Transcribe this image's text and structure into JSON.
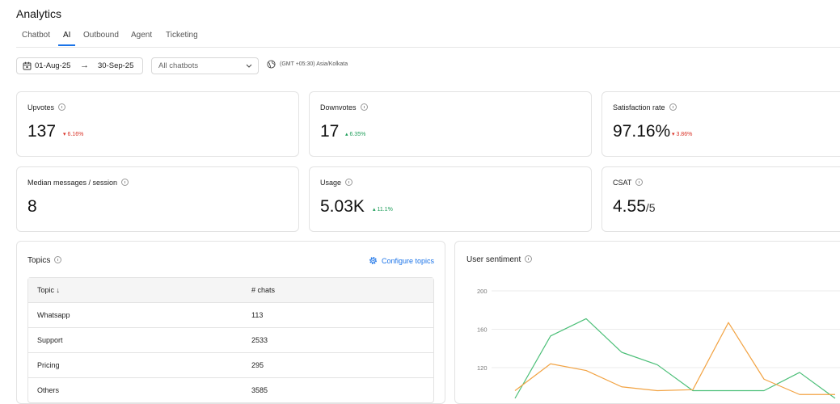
{
  "page": {
    "title": "Analytics"
  },
  "tabs": [
    {
      "label": "Chatbot",
      "active": false
    },
    {
      "label": "AI",
      "active": true
    },
    {
      "label": "Outbound",
      "active": false
    },
    {
      "label": "Agent",
      "active": false
    },
    {
      "label": "Ticketing",
      "active": false
    }
  ],
  "filters": {
    "date_start": "01-Aug-25",
    "date_arrow": "→",
    "date_end": "30-Sep-25",
    "chatbot_select": "All chatbots",
    "timezone": "(GMT +05:30) Asia/Kolkata"
  },
  "metrics": [
    {
      "label": "Upvotes",
      "value": "137",
      "delta": "6.16%",
      "direction": "down"
    },
    {
      "label": "Downvotes",
      "value": "17",
      "delta": "6.35%",
      "direction": "up"
    },
    {
      "label": "Satisfaction rate",
      "value": "97.16%",
      "delta": "3.86%",
      "direction": "down"
    },
    {
      "label": "Median messages / session",
      "value": "8"
    },
    {
      "label": "Usage",
      "value": "5.03K",
      "delta": "11.1%",
      "direction": "up"
    },
    {
      "label": "CSAT",
      "value": "4.55",
      "suffix": "/5"
    }
  ],
  "topics": {
    "title": "Topics",
    "configure_label": "Configure topics",
    "columns": [
      "Topic",
      "# chats"
    ],
    "sort_arrow": "↓",
    "rows": [
      {
        "topic": "Whatsapp",
        "chats": "113"
      },
      {
        "topic": "Support",
        "chats": "2533"
      },
      {
        "topic": "Pricing",
        "chats": "295"
      },
      {
        "topic": "Others",
        "chats": "3585"
      }
    ]
  },
  "sentiment": {
    "title": "User sentiment"
  },
  "colors": {
    "accent": "#1a73e8",
    "positive": "#1e9e5a",
    "negative": "#d93025",
    "series_green": "#4cbf78",
    "series_orange": "#f2a343"
  },
  "chart_data": {
    "type": "line",
    "title": "User sentiment",
    "yticks": [
      120,
      160,
      200
    ],
    "ylim": [
      90,
      210
    ],
    "x": [
      1,
      2,
      3,
      4,
      5,
      6,
      7,
      8,
      9,
      10
    ],
    "series": [
      {
        "color": "#4cbf78",
        "values": [
          88,
          153,
          171,
          136,
          123,
          96,
          96,
          96,
          115,
          88
        ]
      },
      {
        "color": "#f2a343",
        "values": [
          96,
          124,
          117,
          100,
          96,
          97,
          167,
          108,
          92,
          92
        ]
      }
    ]
  }
}
